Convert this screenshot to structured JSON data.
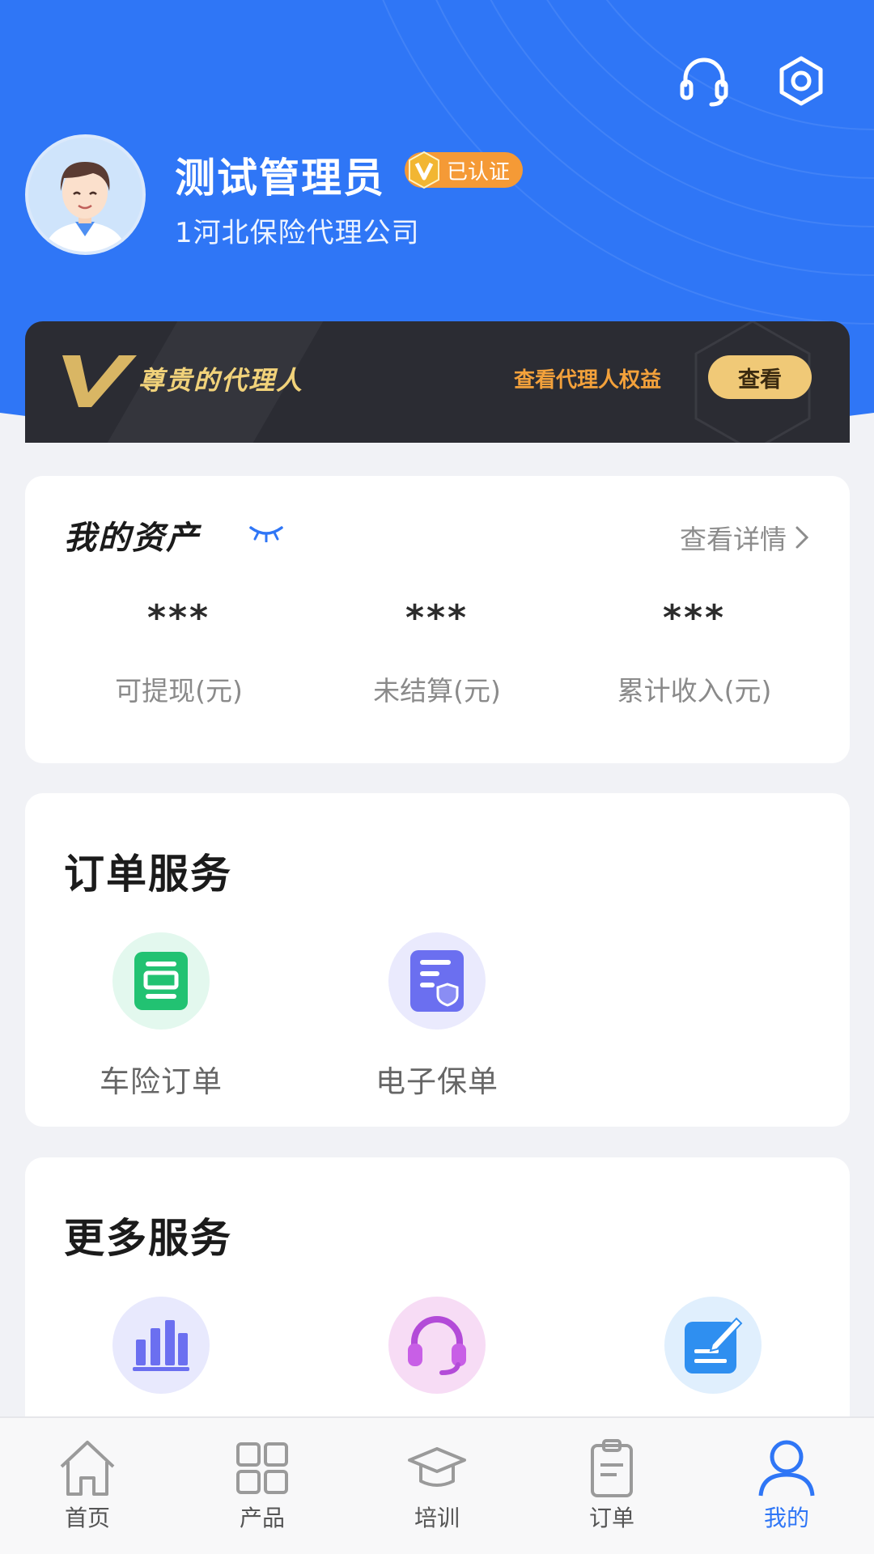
{
  "profile": {
    "name": "测试管理员",
    "verified_label": "已认证",
    "company": "1河北保险代理公司"
  },
  "vip": {
    "title": "尊贵的代理人",
    "link": "查看代理人权益",
    "button": "查看"
  },
  "assets": {
    "title": "我的资产",
    "detail_link": "查看详情",
    "items": [
      {
        "value": "***",
        "label": "可提现(元)"
      },
      {
        "value": "***",
        "label": "未结算(元)"
      },
      {
        "value": "***",
        "label": "累计收入(元)"
      }
    ]
  },
  "order_services": {
    "title": "订单服务",
    "items": [
      {
        "label": "车险订单",
        "icon": "car-order-icon"
      },
      {
        "label": "电子保单",
        "icon": "e-policy-icon"
      }
    ]
  },
  "more_services": {
    "title": "更多服务",
    "items": [
      {
        "icon": "stats-icon"
      },
      {
        "icon": "headset-service-icon"
      },
      {
        "icon": "edit-note-icon"
      }
    ]
  },
  "tabs": [
    {
      "label": "首页",
      "icon": "home-icon"
    },
    {
      "label": "产品",
      "icon": "grid-icon"
    },
    {
      "label": "培训",
      "icon": "graduation-cap-icon"
    },
    {
      "label": "订单",
      "icon": "clipboard-icon"
    },
    {
      "label": "我的",
      "icon": "user-icon",
      "active": true
    }
  ],
  "colors": {
    "primary": "#2f76f6",
    "gold": "#f0c977",
    "orange": "#f59a36"
  }
}
